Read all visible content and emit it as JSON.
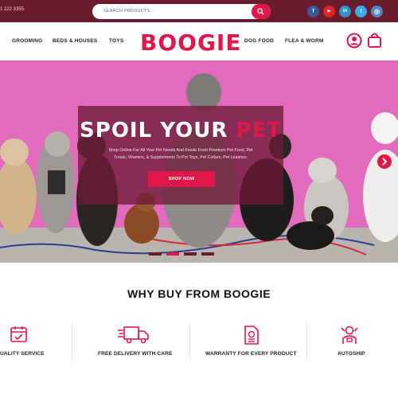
{
  "topbar": {
    "phone": "1 222 3355",
    "search_placeholder": "SEARCH PRODUCTS...",
    "social": [
      {
        "icon": "facebook-icon",
        "glyph": "f",
        "color": "#3b5998"
      },
      {
        "icon": "youtube-icon",
        "glyph": "▶",
        "color": "#e02424"
      },
      {
        "icon": "linkedin-icon",
        "glyph": "in",
        "color": "#3a8fc4"
      },
      {
        "icon": "twitter-icon",
        "glyph": "t",
        "color": "#40a9e8"
      },
      {
        "icon": "instagram-icon",
        "glyph": "◎",
        "color": "#4f86c6"
      }
    ]
  },
  "nav": {
    "left": [
      "GROOMING",
      "BEDS & HOUSES",
      "TOYS"
    ],
    "logo": "BOOGIE",
    "right": [
      "DOG FOOD",
      "FLEA & WORM"
    ],
    "icons": [
      "account-icon",
      "cart-icon"
    ]
  },
  "hero": {
    "title_main": "SPOIL YOUR ",
    "title_accent": "PET",
    "subtitle_line1": "Shop Online For All Your Pet Needs And Feeds From Premium Pet Food, Pet",
    "subtitle_line2": "Treats, Vitamins, & Supplements To Pet Toys, Pet Collars, Pet Leashes.",
    "button": "SHOP NOW",
    "slides_total": 4,
    "active_slide": 2
  },
  "why": {
    "title": "WHY BUY FROM BOOGIE",
    "features": [
      {
        "label": "UALITY SERVICE",
        "icon": "calendar-check-icon"
      },
      {
        "label": "FREE DELIVERY WITH CARE",
        "icon": "delivery-truck-icon"
      },
      {
        "label": "WARRANTY FOR EVERY PRODUCT",
        "icon": "warranty-document-icon"
      },
      {
        "label": "AUTOSHIP",
        "icon": "autoship-robot-icon"
      }
    ]
  },
  "colors": {
    "brand": "#e0174a",
    "topbar": "#6b1c2c",
    "hero_bg": "#e26bbd"
  }
}
